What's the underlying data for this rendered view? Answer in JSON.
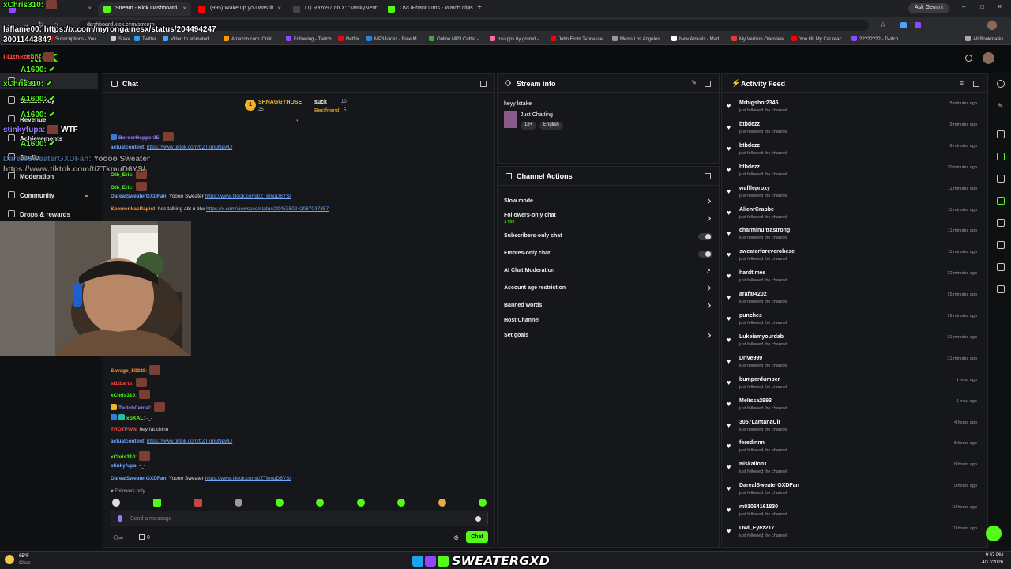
{
  "browser": {
    "tabs": [
      {
        "label": "",
        "color": "#9146ff",
        "active": false
      },
      {
        "label": "Stream - Kick Dashboard",
        "color": "#53fc18",
        "active": true
      },
      {
        "label": "(995) Wake up you was lit",
        "color": "#ff0000",
        "active": false
      },
      {
        "label": "(1) Razo97 on X: \"MarkyNext\"",
        "color": "#222222",
        "active": false
      },
      {
        "label": "OVOPhantuums - Watch clips",
        "color": "#53fc18",
        "active": false
      }
    ],
    "url": "dashboard.kick.com/stream",
    "ask_gemini": "Ask Gemini",
    "bookmarks": [
      "Subscriptions - You...",
      "Stake",
      "Twitter",
      "Video to animated...",
      "Amazon.com: Onlin...",
      "Following - Twitch",
      "Netflix",
      "MP3Juices - Free M...",
      "Online MP3 Cutter -...",
      "osu-pps by grumd -...",
      "John From Tennesse...",
      "Men's Los Angeles...",
      "New Arrivals - Mad...",
      "My Verizon Overview",
      "You Hit My Car reac...",
      "???????? - Twitch"
    ],
    "all_bookmarks": "All Bookmarks"
  },
  "sidebar": {
    "logo": "KICK",
    "items": [
      "Stream",
      "Stream Key",
      "Revenue",
      "Achievements",
      "Studio",
      "Moderation",
      "Community",
      "Drops & rewards"
    ]
  },
  "chat": {
    "title": "Chat",
    "pinned_top": {
      "rank": "1",
      "name": "SHNAGGYHOSE",
      "count": "25",
      "msg": "suck",
      "n2": "10",
      "best": "Bestfriend",
      "n3": "5"
    },
    "messages_top": [
      {
        "user": "BorderHopper25",
        "color": "#9b7cff",
        "text": ""
      },
      {
        "user": "actualcontent",
        "color": "#6ea8ff",
        "text": "https://www.tiktok.com/t/ZTkmuNewL/"
      },
      {
        "user": "Otb_Eric",
        "color": "#53fc18",
        "text": ""
      },
      {
        "user": "Otb_Eric",
        "color": "#53fc18",
        "text": ""
      },
      {
        "user": "DarealSweaterGXDFan",
        "color": "#6ea8ff",
        "text": "Yoooo Sweater ",
        "link": "https://www.tiktok.com/t/ZTkmuD6YS/"
      },
      {
        "user": "SpomenkasRapist",
        "color": "#ff9a3c",
        "text": "hes talking abt u btw ",
        "link": "https://x.com/viewsceo/status/2045350242087047357"
      }
    ],
    "messages_bottom": [
      {
        "user": "Savage_50328",
        "color": "#ff9a3c",
        "text": ""
      },
      {
        "user": "sl1tbarts",
        "color": "#ff4a4a",
        "text": ""
      },
      {
        "user": "xChris310",
        "color": "#53fc18",
        "text": ""
      },
      {
        "user": "TwitchCentel",
        "color": "#9b7cff",
        "text": ""
      },
      {
        "user": "xSKAL",
        "color": "#53fc18",
        "text": "-_-"
      },
      {
        "user": "THOTPWN",
        "color": "#ff4a4a",
        "text": "hey fat chino"
      },
      {
        "user": "actualcontent",
        "color": "#6ea8ff",
        "text": "https://www.tiktok.com/t/ZTkmuNewL/"
      },
      {
        "user": "xChris310",
        "color": "#53fc18",
        "text": ""
      },
      {
        "user": "stinkyfupa",
        "color": "#6ea8ff",
        "text": "-_-"
      },
      {
        "user": "DarealSweaterGXDFan",
        "color": "#6ea8ff",
        "text": "Yoooo Sweater ",
        "link": "https://www.tiktok.com/t/ZTkmuD6YS/"
      }
    ],
    "followers_only": "Followers only",
    "input_placeholder": "Send a message",
    "send_label": "Chat",
    "viewer_count": "0"
  },
  "stream_info": {
    "title": "Stream info",
    "stream_title": "heyy lstake",
    "category": "Just Chatting",
    "tags": [
      "18+",
      "English"
    ]
  },
  "channel_actions": {
    "title": "Channel Actions",
    "rows": [
      {
        "label": "Slow mode",
        "sub": "",
        "kind": "chevron"
      },
      {
        "label": "Followers-only chat",
        "sub": "1 min",
        "kind": "chevron"
      },
      {
        "label": "Subscribers-only chat",
        "sub": "",
        "kind": "toggle"
      },
      {
        "label": "Emotes-only chat",
        "sub": "",
        "kind": "toggle"
      },
      {
        "label": "AI Chat Moderation",
        "sub": "",
        "kind": "external"
      },
      {
        "label": "Account age restriction",
        "sub": "",
        "kind": "chevron"
      },
      {
        "label": "Banned words",
        "sub": "",
        "kind": "chevron"
      },
      {
        "label": "Host Channel",
        "sub": "",
        "kind": "none"
      },
      {
        "label": "Set goals",
        "sub": "",
        "kind": "chevron"
      }
    ]
  },
  "activity": {
    "title": "Activity Feed",
    "sub": "just followed the channel",
    "items": [
      {
        "name": "Mrbigshot2345",
        "time": "5 minutes ago"
      },
      {
        "name": "btbdezz",
        "time": "9 minutes ago"
      },
      {
        "name": "btbdezz",
        "time": "9 minutes ago"
      },
      {
        "name": "btbdezz",
        "time": "10 minutes ago"
      },
      {
        "name": "waffleproxy",
        "time": "11 minutes ago"
      },
      {
        "name": "AlienrCrabbe",
        "time": "11 minutes ago"
      },
      {
        "name": "charminultrastrong",
        "time": "11 minutes ago"
      },
      {
        "name": "sweaterforeverobese",
        "time": "11 minutes ago"
      },
      {
        "name": "hardtimes",
        "time": "12 minutes ago"
      },
      {
        "name": "arafat4202",
        "time": "15 minutes ago"
      },
      {
        "name": "punches",
        "time": "19 minutes ago"
      },
      {
        "name": "Lukeiamyourdab",
        "time": "31 minutes ago"
      },
      {
        "name": "Drive999",
        "time": "31 minutes ago"
      },
      {
        "name": "bumperdumper",
        "time": "1 hour ago"
      },
      {
        "name": "Melissa2993",
        "time": "1 hour ago"
      },
      {
        "name": "3057LantanaCir",
        "time": "4 hours ago"
      },
      {
        "name": "feredinnn",
        "time": "5 hours ago"
      },
      {
        "name": "Niskalion1",
        "time": "8 hours ago"
      },
      {
        "name": "DarealSweaterGXDFan",
        "time": "9 hours ago"
      },
      {
        "name": "m01064161830",
        "time": "10 hours ago"
      },
      {
        "name": "Owl_Eyez217",
        "time": "10 hours ago"
      }
    ]
  },
  "overlay": {
    "lines": [
      {
        "user": "xChris310:",
        "color": "#53fc18",
        "text": ""
      },
      {
        "user": "laflame00:",
        "color": "#ffffff",
        "text": "https://x.com/myrongainesx/status/204494247"
      },
      {
        "user": "",
        "color": "#ffffff",
        "text": "3001144384?"
      },
      {
        "user": "lil1thkdteh:",
        "color": "#ff4a4a",
        "text": ""
      },
      {
        "user": "A1600:",
        "color": "#53fc18",
        "text": ""
      },
      {
        "user": "xChris310:",
        "color": "#53fc18",
        "text": ""
      },
      {
        "user": "A1600:",
        "color": "#53fc18",
        "text": ""
      },
      {
        "user": "A1600:",
        "color": "#53fc18",
        "text": ""
      },
      {
        "user": "stinkyfupa:",
        "color": "#9b7cff",
        "text": "WTF"
      },
      {
        "user": "A1600:",
        "color": "#53fc18",
        "text": ""
      },
      {
        "user": "DarealSweaterGXDFan:",
        "color": "#6ea8ff",
        "text": "Yoooo Sweater"
      },
      {
        "user": "",
        "color": "#ffffff",
        "text": "https://www.tiktok.com/t/ZTkmuD6YS/"
      }
    ],
    "brand": "SWEATERGXD"
  },
  "taskbar": {
    "weather_temp": "65°F",
    "weather_desc": "Clear",
    "time": "9:37 PM",
    "date": "4/17/2026"
  },
  "colors": {
    "kick_green": "#53fc18",
    "panel": "#16171a",
    "bg": "#111214"
  }
}
